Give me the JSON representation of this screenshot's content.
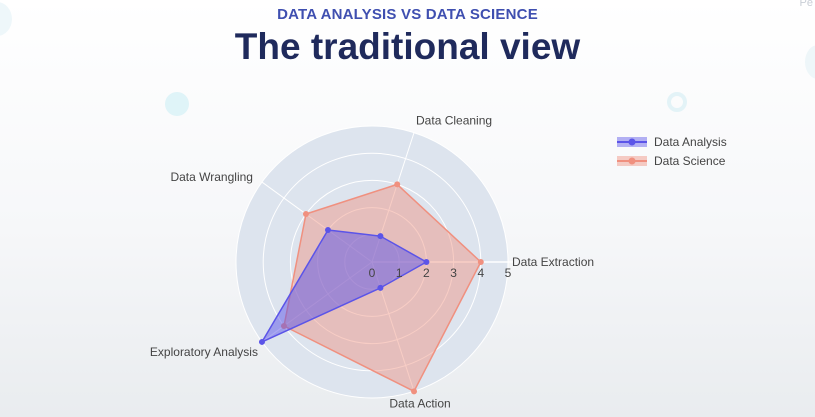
{
  "header": {
    "subtitle": "DATA ANALYSIS VS DATA SCIENCE",
    "title": "The traditional view",
    "corner_text": "Pe"
  },
  "chart_data": {
    "type": "radar",
    "axes": [
      "Data Extraction",
      "Data Cleaning",
      "Data Wrangling",
      "Exploratory Analysis",
      "Data Action"
    ],
    "axis_angles_deg": [
      0,
      72,
      144,
      216,
      288
    ],
    "radial_range": [
      0,
      5
    ],
    "radial_ticks": [
      "0",
      "1",
      "2",
      "3",
      "4",
      "5"
    ],
    "grid": true,
    "legend_position": "top-right",
    "series": [
      {
        "name": "Data Analysis",
        "values": [
          2,
          1,
          2,
          5,
          1
        ],
        "color": "#5b54e8"
      },
      {
        "name": "Data Science",
        "values": [
          4,
          3,
          3,
          4,
          5
        ],
        "color": "#f0907f"
      }
    ]
  }
}
